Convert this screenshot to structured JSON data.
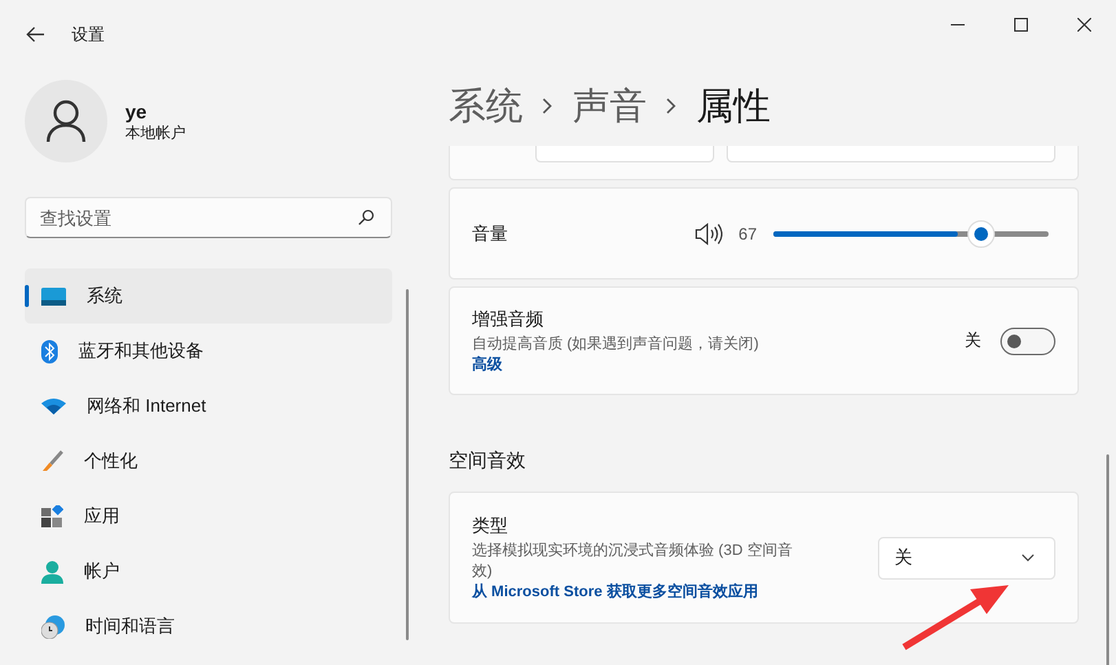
{
  "window": {
    "title": "设置"
  },
  "user": {
    "name": "ye",
    "account_type": "本地帐户"
  },
  "search": {
    "placeholder": "查找设置"
  },
  "nav": [
    {
      "label": "系统",
      "kind": "system",
      "selected": true
    },
    {
      "label": "蓝牙和其他设备",
      "kind": "bluetooth",
      "selected": false
    },
    {
      "label": "网络和 Internet",
      "kind": "network",
      "selected": false
    },
    {
      "label": "个性化",
      "kind": "personalize",
      "selected": false
    },
    {
      "label": "应用",
      "kind": "apps",
      "selected": false
    },
    {
      "label": "帐户",
      "kind": "accounts",
      "selected": false
    },
    {
      "label": "时间和语言",
      "kind": "time",
      "selected": false
    }
  ],
  "breadcrumb": [
    "系统",
    "声音",
    "属性"
  ],
  "volume": {
    "label": "音量",
    "reading": "67",
    "level": 0.67
  },
  "enhance": {
    "title": "增强音频",
    "description": "自动提高音质 (如果遇到声音问题，请关闭)",
    "link": "高级",
    "state_label": "关",
    "on": false
  },
  "spatial": {
    "heading": "空间音效",
    "title": "类型",
    "description": "选择模拟现实环境的沉浸式音频体验 (3D 空间音效)",
    "link": "从 Microsoft Store 获取更多空间音效应用",
    "value": "关"
  }
}
